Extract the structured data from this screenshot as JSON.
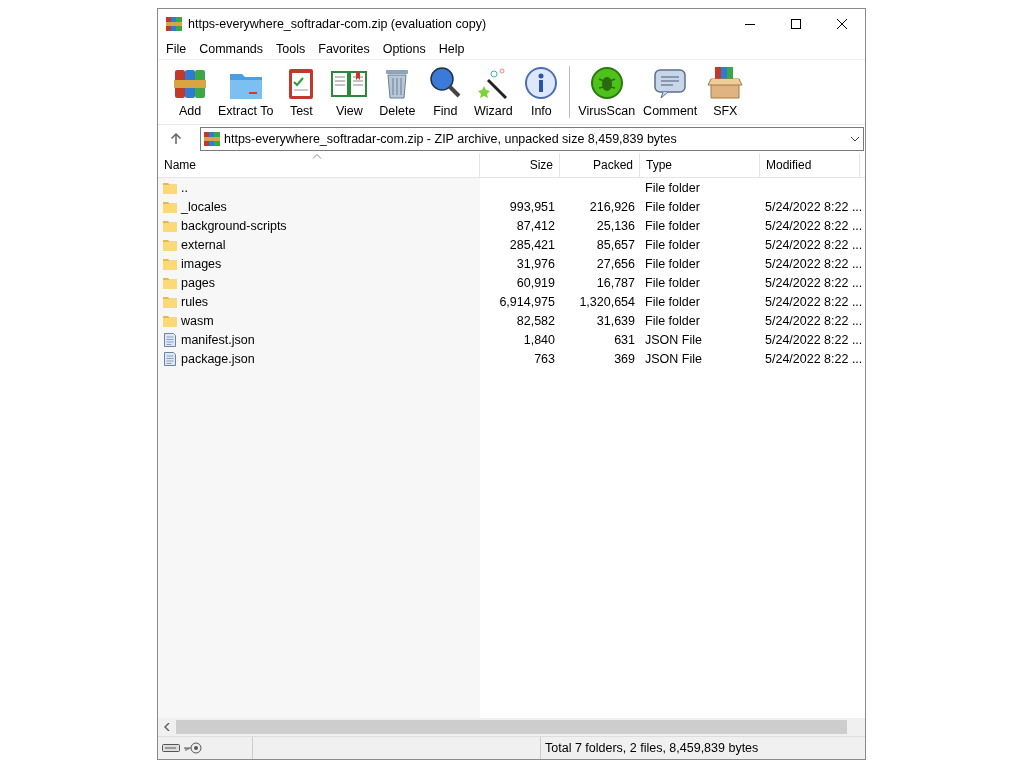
{
  "window": {
    "title": "https-everywhere_softradar-com.zip (evaluation copy)"
  },
  "menu": [
    "File",
    "Commands",
    "Tools",
    "Favorites",
    "Options",
    "Help"
  ],
  "toolbar": [
    {
      "label": "Add",
      "kind": "add"
    },
    {
      "label": "Extract To",
      "kind": "extract"
    },
    {
      "label": "Test",
      "kind": "test"
    },
    {
      "label": "View",
      "kind": "view"
    },
    {
      "label": "Delete",
      "kind": "delete"
    },
    {
      "label": "Find",
      "kind": "find"
    },
    {
      "label": "Wizard",
      "kind": "wizard"
    },
    {
      "label": "Info",
      "kind": "info"
    },
    {
      "label": "VirusScan",
      "kind": "virus"
    },
    {
      "label": "Comment",
      "kind": "comment"
    },
    {
      "label": "SFX",
      "kind": "sfx"
    }
  ],
  "address": {
    "value": "https-everywhere_softradar-com.zip - ZIP archive, unpacked size 8,459,839 bytes"
  },
  "table": {
    "columns": [
      {
        "label": "Name",
        "sorted": true
      },
      {
        "label": "Size",
        "sorted": false
      },
      {
        "label": "Packed",
        "sorted": false
      },
      {
        "label": "Type",
        "sorted": false
      },
      {
        "label": "Modified",
        "sorted": false
      }
    ],
    "rows": [
      {
        "kind": "folder",
        "cells": [
          "..",
          "",
          "",
          "File folder",
          ""
        ]
      },
      {
        "kind": "folder",
        "cells": [
          "_locales",
          "993,951",
          "216,926",
          "File folder",
          "5/24/2022 8:22 ..."
        ]
      },
      {
        "kind": "folder",
        "cells": [
          "background-scripts",
          "87,412",
          "25,136",
          "File folder",
          "5/24/2022 8:22 ..."
        ]
      },
      {
        "kind": "folder",
        "cells": [
          "external",
          "285,421",
          "85,657",
          "File folder",
          "5/24/2022 8:22 ..."
        ]
      },
      {
        "kind": "folder",
        "cells": [
          "images",
          "31,976",
          "27,656",
          "File folder",
          "5/24/2022 8:22 ..."
        ]
      },
      {
        "kind": "folder",
        "cells": [
          "pages",
          "60,919",
          "16,787",
          "File folder",
          "5/24/2022 8:22 ..."
        ]
      },
      {
        "kind": "folder",
        "cells": [
          "rules",
          "6,914,975",
          "1,320,654",
          "File folder",
          "5/24/2022 8:22 ..."
        ]
      },
      {
        "kind": "folder",
        "cells": [
          "wasm",
          "82,582",
          "31,639",
          "File folder",
          "5/24/2022 8:22 ..."
        ]
      },
      {
        "kind": "file",
        "cells": [
          "manifest.json",
          "1,840",
          "631",
          "JSON File",
          "5/24/2022 8:22 ..."
        ]
      },
      {
        "kind": "file",
        "cells": [
          "package.json",
          "763",
          "369",
          "JSON File",
          "5/24/2022 8:22 ..."
        ]
      }
    ]
  },
  "status_bar": {
    "text": "Total 7 folders, 2 files, 8,459,839 bytes"
  }
}
